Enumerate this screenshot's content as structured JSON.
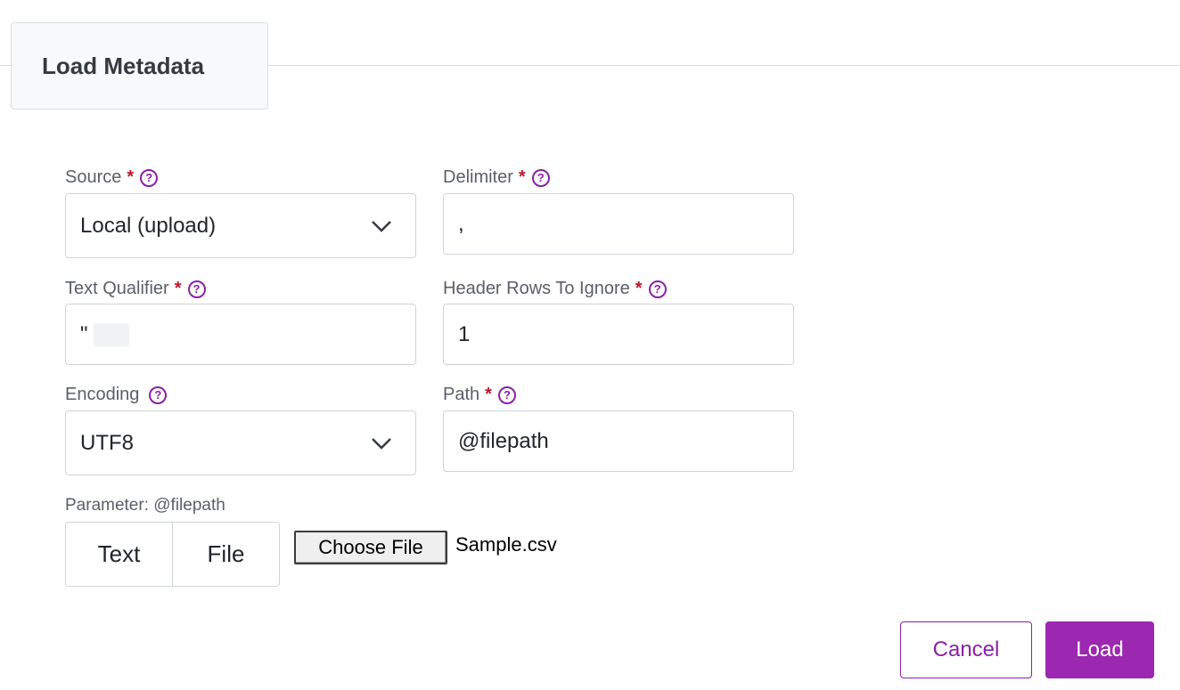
{
  "tab": {
    "title": "Load Metadata"
  },
  "form": {
    "source": {
      "label": "Source",
      "value": "Local (upload)"
    },
    "delimiter": {
      "label": "Delimiter",
      "value": ","
    },
    "text_qualifier": {
      "label": "Text Qualifier",
      "value": "\""
    },
    "header_rows": {
      "label": "Header Rows To Ignore",
      "value": "1"
    },
    "encoding": {
      "label": "Encoding",
      "value": "UTF8"
    },
    "path": {
      "label": "Path",
      "value": "@filepath"
    },
    "required_mark": "*",
    "help_glyph": "?"
  },
  "parameter": {
    "label": "Parameter: @filepath",
    "segments": [
      "Text",
      "File"
    ],
    "choose_file_label": "Choose File",
    "file_name": "Sample.csv"
  },
  "actions": {
    "cancel_label": "Cancel",
    "load_label": "Load"
  },
  "colors": {
    "accent": "#9c27b0",
    "required": "#c0152f",
    "border": "#ced4da"
  },
  "icons": {
    "help": "question-circle-icon",
    "dropdown": "chevron-down-icon"
  }
}
